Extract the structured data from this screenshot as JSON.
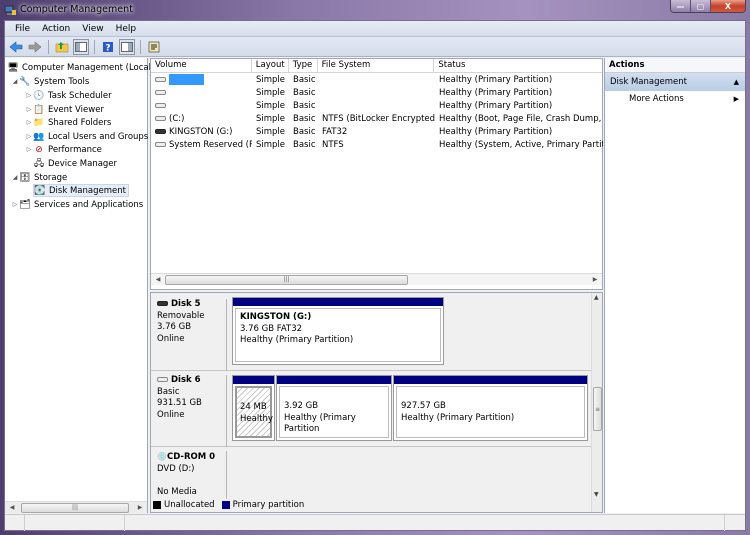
{
  "window": {
    "title": "Computer Management",
    "minimize": "—",
    "maximize": "▢",
    "close": "X"
  },
  "menu": [
    "File",
    "Action",
    "View",
    "Help"
  ],
  "toolbar": {
    "icons": [
      "back-arrow",
      "forward-arrow",
      "up-folder",
      "show-hide-console-tree",
      "help",
      "show-hide-action-pane",
      "properties"
    ]
  },
  "tree": {
    "root": "Computer Management (Local",
    "system_tools": "System Tools",
    "task_scheduler": "Task Scheduler",
    "event_viewer": "Event Viewer",
    "shared_folders": "Shared Folders",
    "local_users": "Local Users and Groups",
    "performance": "Performance",
    "device_manager": "Device Manager",
    "storage": "Storage",
    "disk_management": "Disk Management",
    "services": "Services and Applications"
  },
  "volumes": {
    "headers": [
      "Volume",
      "Layout",
      "Type",
      "File System",
      "Status"
    ],
    "rows": [
      {
        "volume": "",
        "layout": "Simple",
        "type": "Basic",
        "fs": "",
        "status": "Healthy (Primary Partition)",
        "selected": true
      },
      {
        "volume": "",
        "layout": "Simple",
        "type": "Basic",
        "fs": "",
        "status": "Healthy (Primary Partition)"
      },
      {
        "volume": "",
        "layout": "Simple",
        "type": "Basic",
        "fs": "",
        "status": "Healthy (Primary Partition)"
      },
      {
        "volume": "(C:)",
        "layout": "Simple",
        "type": "Basic",
        "fs": "NTFS (BitLocker Encrypted)",
        "status": "Healthy (Boot, Page File, Crash Dump, P"
      },
      {
        "volume": "KINGSTON (G:)",
        "layout": "Simple",
        "type": "Basic",
        "fs": "FAT32",
        "status": "Healthy (Primary Partition)"
      },
      {
        "volume": "System Reserved (P:)",
        "layout": "Simple",
        "type": "Basic",
        "fs": "NTFS",
        "status": "Healthy (System, Active, Primary Partitio"
      }
    ]
  },
  "disks": [
    {
      "name": "Disk 5",
      "kind": "Removable",
      "size": "3.76 GB",
      "state": "Online",
      "partitions": [
        {
          "title": "KINGSTON  (G:)",
          "line1": "3.76 GB FAT32",
          "line2": "Healthy (Primary Partition)"
        }
      ]
    },
    {
      "name": "Disk 6",
      "kind": "Basic",
      "size": "931.51 GB",
      "state": "Online",
      "partitions": [
        {
          "line1": "24 MB",
          "line2": "Healthy"
        },
        {
          "line1": "3.92 GB",
          "line2": "Healthy (Primary Partition"
        },
        {
          "line1": "927.57 GB",
          "line2": "Healthy (Primary Partition)"
        }
      ]
    },
    {
      "name": "CD-ROM 0",
      "kind": "DVD (D:)",
      "size": "",
      "state": "No Media"
    }
  ],
  "legend": [
    {
      "label": "Unallocated",
      "color": "#000000"
    },
    {
      "label": "Primary partition",
      "color": "#000080"
    }
  ],
  "actions": {
    "header": "Actions",
    "section": "Disk Management",
    "item": "More Actions"
  }
}
